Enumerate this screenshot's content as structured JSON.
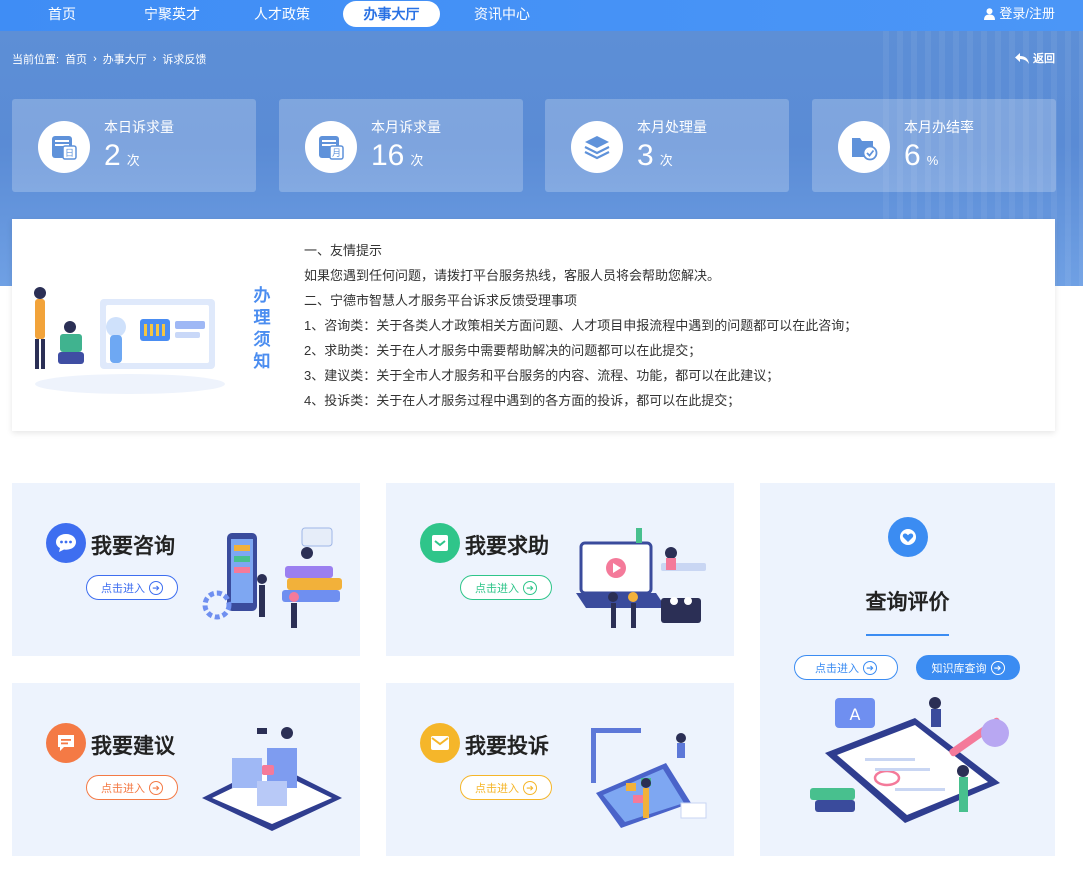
{
  "nav": {
    "items": [
      {
        "label": "首页"
      },
      {
        "label": "宁聚英才"
      },
      {
        "label": "人才政策"
      },
      {
        "label": "办事大厅"
      },
      {
        "label": "资讯中心"
      }
    ],
    "login": "登录/注册"
  },
  "breadcrumb": {
    "prefix": "当前位置:",
    "items": [
      "首页",
      "办事大厅",
      "诉求反馈"
    ],
    "sep": "›"
  },
  "back_label": "返回",
  "stats": [
    {
      "label": "本日诉求量",
      "value": "2",
      "unit": "次",
      "icon": "calendar-day-icon"
    },
    {
      "label": "本月诉求量",
      "value": "16",
      "unit": "次",
      "icon": "calendar-month-icon"
    },
    {
      "label": "本月处理量",
      "value": "3",
      "unit": "次",
      "icon": "layers-icon"
    },
    {
      "label": "本月办结率",
      "value": "6",
      "unit": "%",
      "icon": "folder-check-icon"
    }
  ],
  "notice": {
    "title_chars": [
      "办",
      "理",
      "须",
      "知"
    ],
    "lines": [
      "一、友情提示",
      "如果您遇到任何问题，请拨打平台服务热线，客服人员将会帮助您解决。",
      "二、宁德市智慧人才服务平台诉求反馈受理事项",
      "1、咨询类：关于各类人才政策相关方面问题、人才项目申报流程中遇到的问题都可以在此咨询；",
      "2、求助类：关于在人才服务中需要帮助解决的问题都可以在此提交；",
      "3、建议类：关于全市人才服务和平台服务的内容、流程、功能，都可以在此建议；",
      "4、投诉类：关于在人才服务过程中遇到的各方面的投诉，都可以在此提交；"
    ]
  },
  "cards": {
    "consult": {
      "title": "我要咨询",
      "button": "点击进入",
      "color": "#3e6ef0",
      "icon": "chat-bubble-icon"
    },
    "help": {
      "title": "我要求助",
      "button": "点击进入",
      "color": "#2fc58a",
      "icon": "envelope-open-icon"
    },
    "suggest": {
      "title": "我要建议",
      "button": "点击进入",
      "color": "#f47a45",
      "icon": "message-lines-icon"
    },
    "complain": {
      "title": "我要投诉",
      "button": "点击进入",
      "color": "#f5b62a",
      "icon": "mail-icon"
    },
    "evaluate": {
      "title": "查询评价",
      "button": "点击进入",
      "kb_button": "知识库查询",
      "color": "#3b8cf2",
      "icon": "heart-shield-icon"
    }
  }
}
